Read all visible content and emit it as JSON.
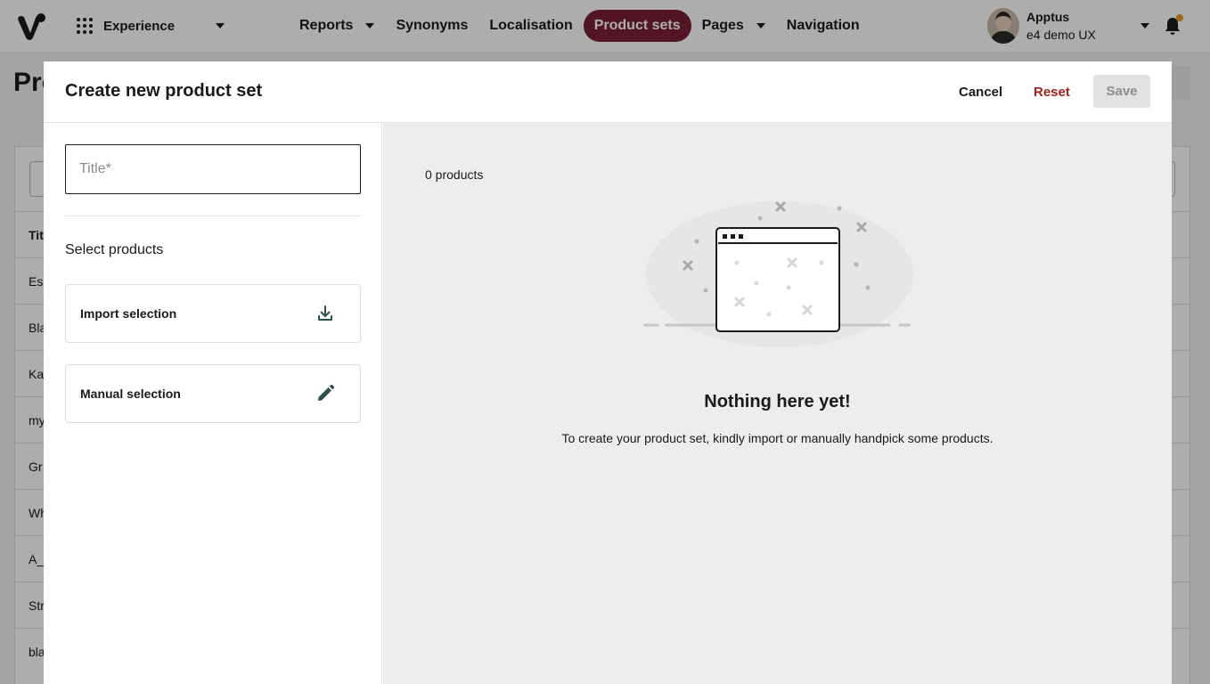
{
  "nav": {
    "app_switcher_label": "Experience",
    "items": [
      {
        "label": "Reports",
        "has_menu": true
      },
      {
        "label": "Synonyms",
        "has_menu": false
      },
      {
        "label": "Localisation",
        "has_menu": false
      },
      {
        "label": "Product sets",
        "has_menu": false,
        "active": true
      },
      {
        "label": "Pages",
        "has_menu": true
      },
      {
        "label": "Navigation",
        "has_menu": false
      }
    ],
    "active_color": "#7a1f35",
    "user": {
      "name": "Apptus",
      "account": "e4 demo UX"
    },
    "notification_dot_color": "#e89b2a"
  },
  "background_page": {
    "title": "Pro",
    "table_header": "Tit",
    "rows": [
      "Es",
      "Bla",
      "Ka",
      "my",
      "Gr",
      "Wh",
      "A_",
      "Str",
      "bla"
    ]
  },
  "modal": {
    "title": "Create new product set",
    "cancel_label": "Cancel",
    "reset_label": "Reset",
    "save_label": "Save",
    "reset_color": "#a0241c",
    "title_input": {
      "placeholder": "Title*",
      "value": ""
    },
    "select_products_label": "Select products",
    "options": {
      "import_label": "Import selection",
      "import_icon": "download-icon",
      "manual_label": "Manual selection",
      "manual_icon": "pencil-icon"
    },
    "product_count": "0 products",
    "empty_state": {
      "title": "Nothing here yet!",
      "description": "To create your product set, kindly import or manually handpick some products.",
      "illustration_icon": "empty-window-illustration"
    }
  }
}
